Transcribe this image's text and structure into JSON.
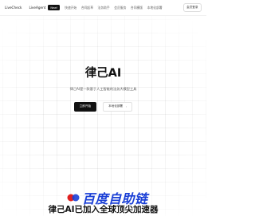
{
  "topbar": {
    "brand_primary": "LiveCheck",
    "brand_secondary": "LiveAgent",
    "badge": "New!",
    "nav_items": [
      "快速开始",
      "合同起草",
      "法务助手",
      "会员服务",
      "合同模版",
      "本地化部署"
    ],
    "login_label": "会员登录"
  },
  "hero": {
    "title": "律己AI",
    "subtitle": "律己AI是一款基于人工智能的法务大模型工具",
    "primary_cta": "立即开始",
    "secondary_cta": "本地化部署"
  },
  "watermark": {
    "text": "百度自助链"
  },
  "footer": {
    "headline": "律己AI已加入全球顶尖加速器"
  },
  "colors": {
    "primary": "#111111",
    "watermark_blue": "#1a3fd6",
    "watermark_red": "#e02020"
  }
}
